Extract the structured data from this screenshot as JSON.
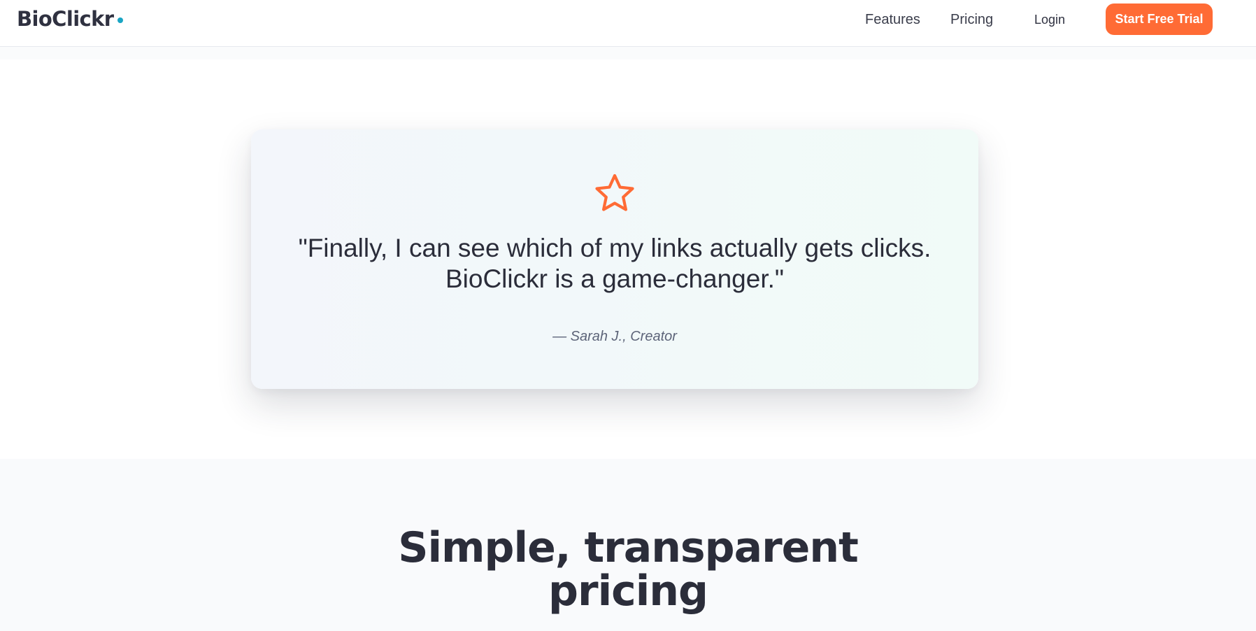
{
  "header": {
    "logo_text": "BioClickr",
    "logo_dot_color": "#1aa5c4",
    "nav": {
      "features_label": "Features",
      "pricing_label": "Pricing",
      "login_label": "Login"
    },
    "cta_label": "Start Free Trial",
    "cta_color": "#ff6b35"
  },
  "testimonial": {
    "icon": "star-icon",
    "icon_color": "#ff6b35",
    "quote": "\"Finally, I can see which of my links actually gets clicks. BioClickr is a game-changer.\"",
    "attribution": "— Sarah J., Creator"
  },
  "pricing": {
    "heading": "Simple, transparent pricing"
  }
}
